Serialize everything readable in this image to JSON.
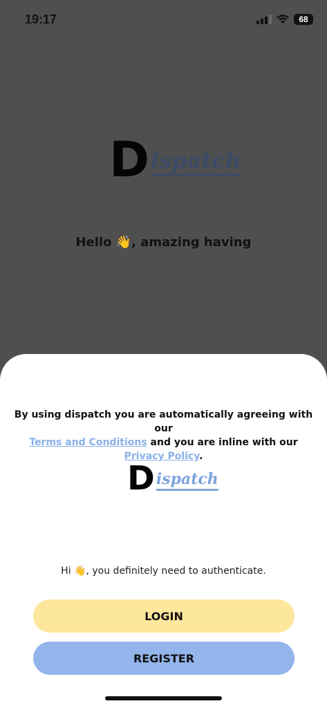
{
  "status_bar": {
    "time": "19:17",
    "battery": "68",
    "icons": [
      "signal-icon",
      "wifi-icon",
      "battery-icon"
    ]
  },
  "logo": {
    "initial": "D",
    "rest": "ispatch"
  },
  "greeting": {
    "before": "Hello ",
    "emoji": "👋",
    "after": ", amazing having"
  },
  "sheet": {
    "terms_prefix": "By using dispatch you are automatically agreeing with our",
    "terms_link": "Terms and Conditions",
    "terms_middle": " and you are inline with our ",
    "privacy_link": "Privacy Policy",
    "terms_suffix": ".",
    "hi_before": "Hi ",
    "hi_emoji": "👋",
    "hi_after": ", you definitely need to authenticate.",
    "login_label": "LOGIN",
    "register_label": "REGISTER"
  },
  "colors": {
    "backdrop": "#4f4f4f",
    "login": "#fde79d",
    "register": "#93b5ec",
    "link": "#8ab0e8"
  }
}
